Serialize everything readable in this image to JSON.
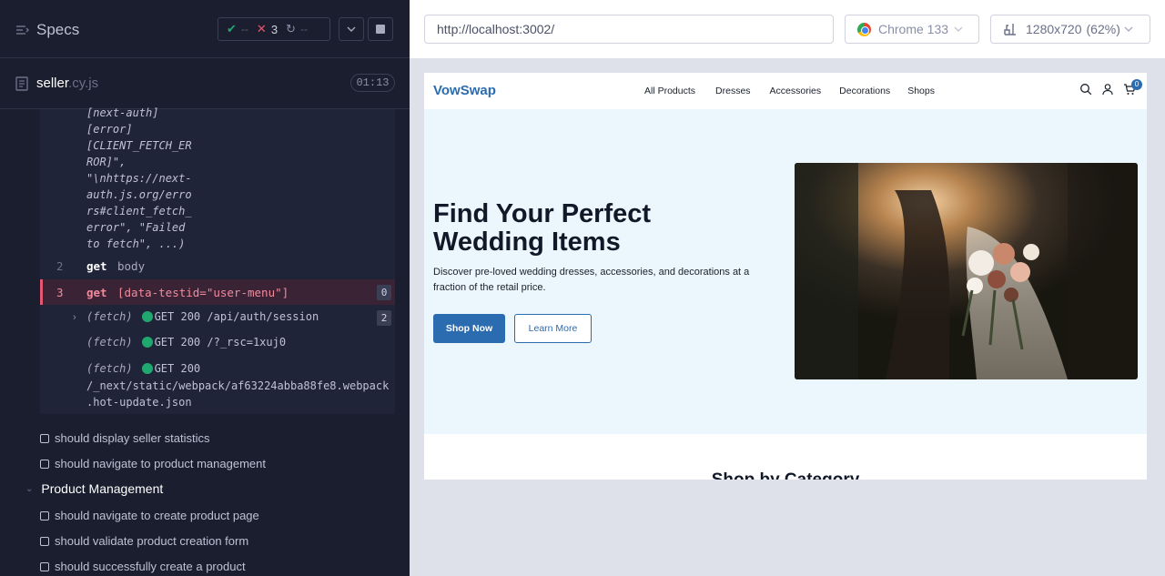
{
  "runner": {
    "specs_label": "Specs",
    "stats": {
      "passed": "--",
      "failed": "3",
      "pending": "--"
    },
    "spec_file": {
      "name": "seller",
      "ext": ".cy.js",
      "duration": "01:13"
    },
    "error_text": "[next-auth]\n[error]\n[CLIENT_FETCH_ER\nROR]\",\n\"\\nhttps://next-\nauth.js.org/erro\nrs#client_fetch_\nerror\", \"Failed\nto fetch\", ...)",
    "commands": [
      {
        "num": "2",
        "name": "get",
        "arg": "body"
      },
      {
        "num": "3",
        "name": "get",
        "arg": "[data-testid=\"user-menu\"]",
        "count": "0"
      }
    ],
    "fetches": [
      {
        "label": "(fetch)",
        "req": "GET 200 /api/auth/session",
        "count": "2"
      },
      {
        "label": "(fetch)",
        "req": "GET 200 /?_rsc=1xuj0"
      },
      {
        "label": "(fetch)",
        "req_line1": "GET 200",
        "req_line2": "/_next/static/webpack/af63224abba88fe8.webpack",
        "req_line3": ".hot-update.json"
      }
    ],
    "tests_before": [
      "should display seller statistics",
      "should navigate to product management"
    ],
    "suite": "Product Management",
    "tests_after": [
      "should navigate to create product page",
      "should validate product creation form",
      "should successfully create a product"
    ]
  },
  "browser": {
    "url": "http://localhost:3002/",
    "name": "Chrome 133",
    "viewport": "1280x720",
    "zoom": "(62%)"
  },
  "site": {
    "logo": "VowSwap",
    "nav": [
      "All Products",
      "Dresses",
      "Accessories",
      "Decorations",
      "Shops"
    ],
    "cart_count": "0",
    "hero_title": "Find Your Perfect Wedding Items",
    "hero_text": "Discover pre-loved wedding dresses, accessories, and decorations at a fraction of the retail price.",
    "cta_primary": "Shop Now",
    "cta_secondary": "Learn More",
    "section_title": "Shop by Category"
  },
  "colors": {
    "brand": "#2b6cb0",
    "fail": "#e45770",
    "pass": "#1fa971",
    "hero_bg": "#ebf6fd"
  },
  "icons": [
    "specs-icon",
    "check-icon",
    "x-icon",
    "spinner-icon",
    "chevron-down-icon",
    "stop-icon",
    "file-icon",
    "chrome-icon",
    "viewport-icon",
    "search-icon",
    "user-icon",
    "cart-icon"
  ]
}
